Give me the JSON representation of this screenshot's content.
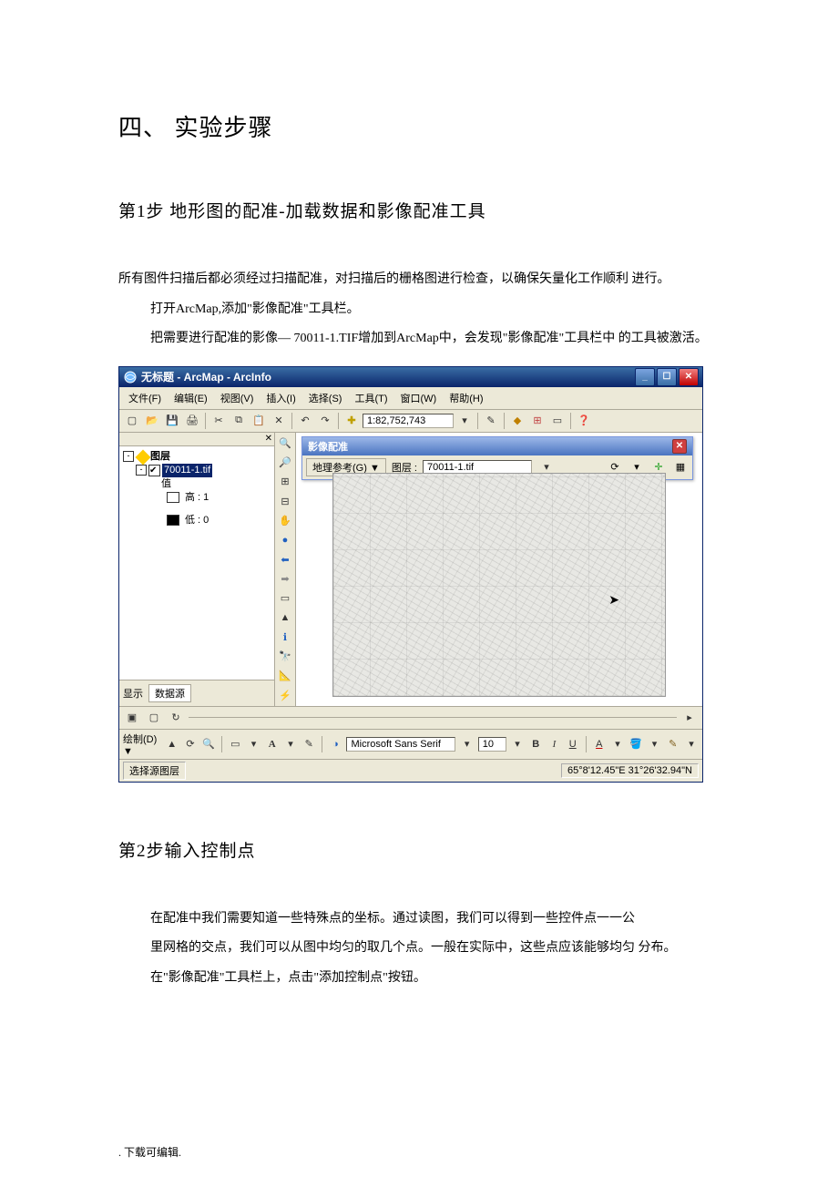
{
  "section_title": "四、 实验步骤",
  "step1": {
    "title": "第1步  地形图的配准-加载数据和影像配准工具",
    "p1": "所有图件扫描后都必须经过扫描配准，对扫描后的栅格图进行检查，以确保矢量化工作顺利 进行。",
    "p2": "打开ArcMap,添加\"影像配准\"工具栏。",
    "p3": "把需要进行配准的影像— 70011-1.TIF增加到ArcMap中，会发现\"影像配准\"工具栏中 的工具被激活。"
  },
  "arcmap": {
    "title": "无标题 - ArcMap - ArcInfo",
    "menus": [
      "文件(F)",
      "编辑(E)",
      "视图(V)",
      "插入(I)",
      "选择(S)",
      "工具(T)",
      "窗口(W)",
      "帮助(H)"
    ],
    "scale": "1:82,752,743",
    "toc": {
      "root": "图层",
      "layer": "70011-1.tif",
      "value_label": "值",
      "hi": "高 : 1",
      "lo": "低 : 0",
      "footer_show": "显示",
      "footer_source": "数据源"
    },
    "georef": {
      "title": "影像配准",
      "dropdown": "地理参考(G) ▼",
      "layer_label": "图层 :",
      "layer_value": "70011-1.tif"
    },
    "draw": {
      "label": "绘制(D) ▼",
      "font": "Microsoft Sans Serif",
      "size": "10"
    },
    "status": {
      "left": "选择源图层",
      "coords": "65°8'12.45\"E  31°26'32.94\"N"
    }
  },
  "step2": {
    "title": "第2步输入控制点",
    "p1": "在配准中我们需要知道一些特殊点的坐标。通过读图，我们可以得到一些控件点一一公",
    "p2": "里网格的交点，我们可以从图中均匀的取几个点。一般在实际中，这些点应该能够均匀 分布。",
    "p3": "在\"影像配准\"工具栏上，点击\"添加控制点\"按钮。"
  },
  "footer": ". 下载可编辑."
}
